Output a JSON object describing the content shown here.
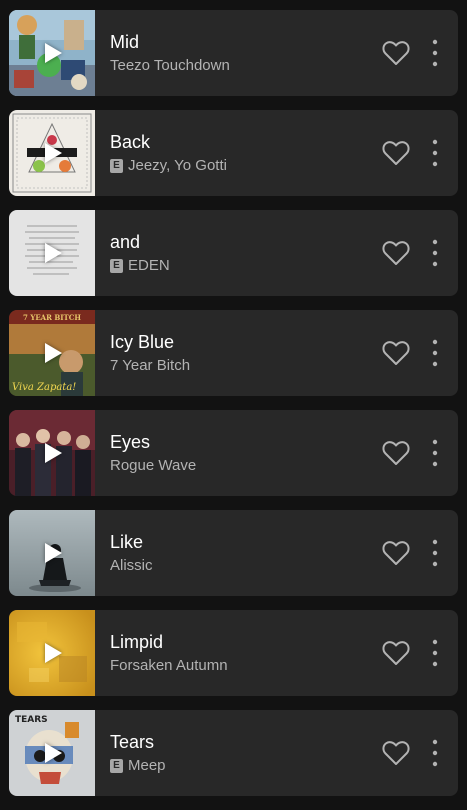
{
  "tracks": [
    {
      "title": "Mid",
      "artist": "Teezo Touchdown",
      "explicit": false,
      "art": "collage"
    },
    {
      "title": "Back",
      "artist": "Jeezy, Yo Gotti",
      "explicit": true,
      "explicit_label": "E",
      "art": "recession-proof"
    },
    {
      "title": "and",
      "artist": "EDEN",
      "explicit": true,
      "explicit_label": "E",
      "art": "text-page"
    },
    {
      "title": "Icy Blue",
      "artist": "7 Year Bitch",
      "explicit": false,
      "art": "viva-zapata",
      "art_text": "Viva Zapata!",
      "art_banner": "7 YEAR BITCH"
    },
    {
      "title": "Eyes",
      "artist": "Rogue Wave",
      "explicit": false,
      "art": "band-photo"
    },
    {
      "title": "Like",
      "artist": "Alissic",
      "explicit": false,
      "art": "sitting-figure"
    },
    {
      "title": "Limpid",
      "artist": "Forsaken Autumn",
      "explicit": false,
      "art": "yellow-texture"
    },
    {
      "title": "Tears",
      "artist": "Meep",
      "explicit": true,
      "explicit_label": "E",
      "art": "skull",
      "art_text": "TEARS"
    }
  ],
  "icons": {
    "play": "play-icon",
    "like": "heart-outline-icon",
    "more": "vertical-dots-icon"
  },
  "colors": {
    "background": "#121212",
    "card": "#282828",
    "title": "#ffffff",
    "subtitle": "#b3b3b3"
  }
}
